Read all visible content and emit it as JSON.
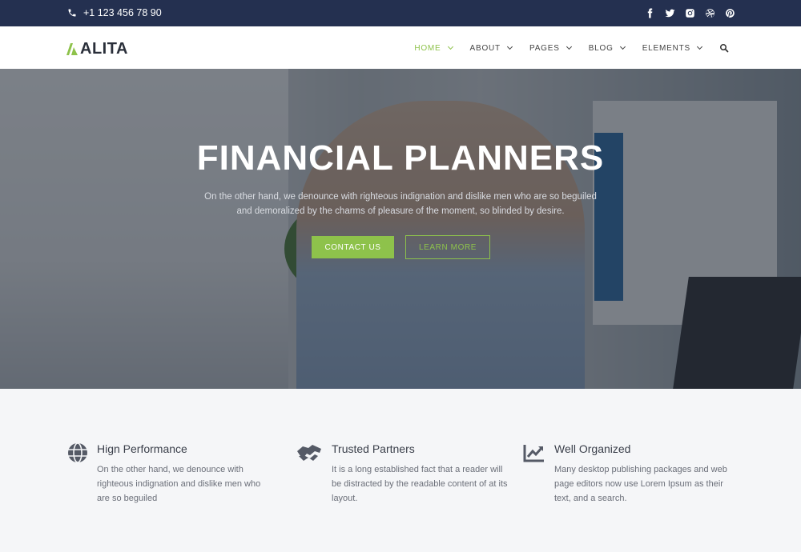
{
  "topbar": {
    "phone": "+1 123 456 78 90",
    "social_icons": [
      "facebook-icon",
      "twitter-icon",
      "instagram-icon",
      "dribbble-icon",
      "pinterest-icon"
    ]
  },
  "nav": {
    "logo": "ALITA",
    "items": [
      {
        "label": "HOME",
        "active": true
      },
      {
        "label": "ABOUT"
      },
      {
        "label": "PAGES"
      },
      {
        "label": "BLOG"
      },
      {
        "label": "ELEMENTS"
      }
    ]
  },
  "hero": {
    "title": "FINANCIAL PLANNERS",
    "subtitle": "On the other hand, we denounce with righteous indignation and dislike men who are so beguiled and demoralized by the charms of pleasure of the moment, so blinded by desire.",
    "contact_label": "CONTACT US",
    "learn_label": "LEARN MORE"
  },
  "features": [
    {
      "icon": "globe-icon",
      "title": "Hign Performance",
      "text": "On the other hand, we denounce with righteous indignation and dislike men who are so beguiled"
    },
    {
      "icon": "handshake-icon",
      "title": "Trusted Partners",
      "text": "It is a long established fact that a reader will be distracted by the readable content of at its layout."
    },
    {
      "icon": "chart-icon",
      "title": "Well Organized",
      "text": "Many desktop publishing packages and web page editors now use Lorem Ipsum as their text, and a search."
    }
  ],
  "colors": {
    "accent": "#8ec24b",
    "topbar": "#243050",
    "text": "#3a3f4a"
  }
}
